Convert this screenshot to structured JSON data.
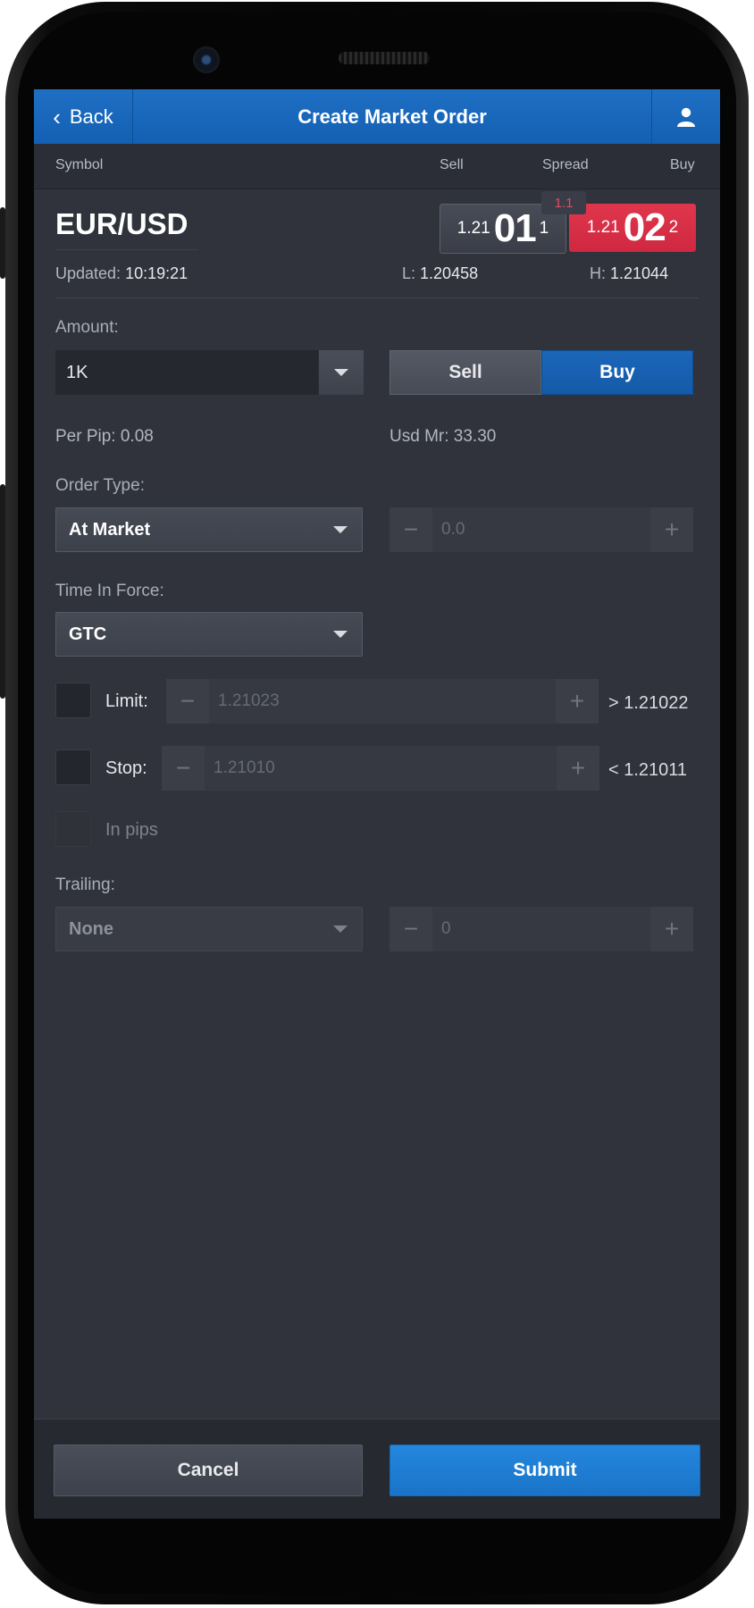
{
  "header": {
    "back_label": "Back",
    "title": "Create Market Order"
  },
  "columns": {
    "symbol": "Symbol",
    "sell": "Sell",
    "spread": "Spread",
    "buy": "Buy"
  },
  "instrument": {
    "symbol": "EUR/USD",
    "updated_label": "Updated:",
    "updated_time": "10:19:21",
    "sell": {
      "prefix": "1.21",
      "big": "01",
      "pip": "1"
    },
    "buy": {
      "prefix": "1.21",
      "big": "02",
      "pip": "2"
    },
    "spread": "1.1",
    "low_label": "L:",
    "low": "1.20458",
    "high_label": "H:",
    "high": "1.21044"
  },
  "amount": {
    "label": "Amount:",
    "value": "1K"
  },
  "side": {
    "sell_label": "Sell",
    "buy_label": "Buy",
    "selected": "Buy"
  },
  "per_pip": "Per Pip: 0.08",
  "margin": "Usd Mr: 33.30",
  "order_type": {
    "label": "Order Type:",
    "value": "At Market",
    "price": "0.0",
    "minus": "−",
    "plus": "+"
  },
  "time_in_force": {
    "label": "Time In Force:",
    "value": "GTC"
  },
  "limit": {
    "label": "Limit:",
    "value": "1.21023",
    "bound": "> 1.21022",
    "minus": "−",
    "plus": "+"
  },
  "stop": {
    "label": "Stop:",
    "value": "1.21010",
    "bound": "< 1.21011",
    "minus": "−",
    "plus": "+"
  },
  "in_pips": {
    "label": "In pips"
  },
  "trailing": {
    "label": "Trailing:",
    "value": "None",
    "amount": "0",
    "minus": "−",
    "plus": "+"
  },
  "footer": {
    "cancel_label": "Cancel",
    "submit_label": "Submit"
  },
  "colors": {
    "header_blue": "#1a68bd",
    "buy_red": "#d92e46",
    "buy_selected": "#1760b0",
    "submit_blue": "#1f7ed3",
    "background": "#30333c"
  },
  "icons": {
    "back": "chevron-left-icon",
    "user": "user-icon",
    "dropdown": "caret-down-icon"
  }
}
